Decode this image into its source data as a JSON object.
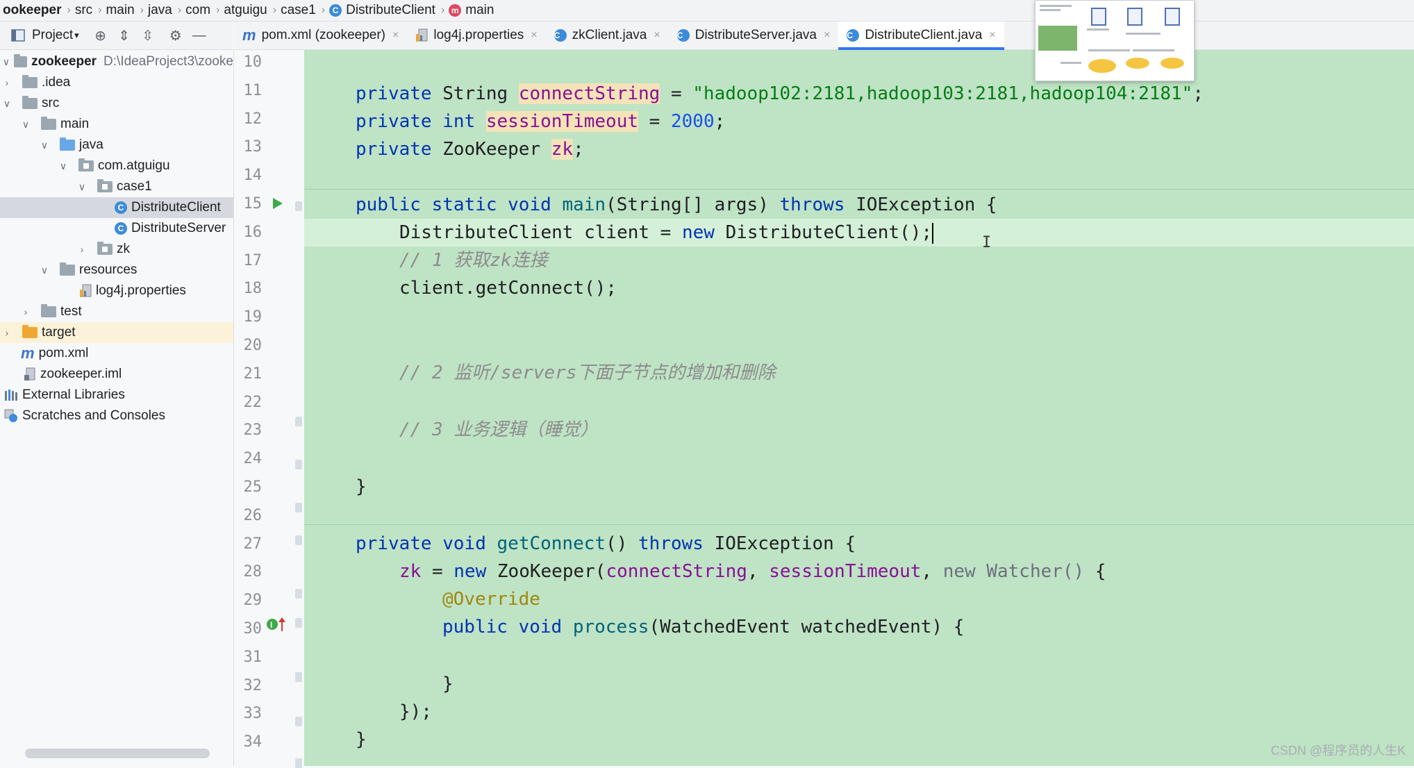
{
  "breadcrumb": [
    "ookeeper",
    "src",
    "main",
    "java",
    "com",
    "atguigu",
    "case1",
    "DistributeClient",
    "main"
  ],
  "project_toolbar": {
    "view_label": "Project"
  },
  "tabs": [
    {
      "label": "pom.xml (zookeeper)",
      "icon": "maven-icon"
    },
    {
      "label": "log4j.properties",
      "icon": "properties-icon"
    },
    {
      "label": "zkClient.java",
      "icon": "class-icon"
    },
    {
      "label": "DistributeServer.java",
      "icon": "class-icon"
    },
    {
      "label": "DistributeClient.java",
      "icon": "class-icon",
      "active": true
    }
  ],
  "tree": {
    "root_name": "zookeeper",
    "root_path": "D:\\IdeaProject3\\zooke",
    "idea": ".idea",
    "src": "src",
    "main": "main",
    "java": "java",
    "pkg": "com.atguigu",
    "case1": "case1",
    "client": "DistributeClient",
    "server": "DistributeServer",
    "zk": "zk",
    "resources": "resources",
    "log4j": "log4j.properties",
    "test": "test",
    "target": "target",
    "pom": "pom.xml",
    "iml": "zookeeper.iml",
    "ext": "External Libraries",
    "scratches": "Scratches and Consoles"
  },
  "line_numbers": [
    "10",
    "11",
    "12",
    "13",
    "14",
    "15",
    "16",
    "17",
    "18",
    "19",
    "20",
    "21",
    "22",
    "23",
    "24",
    "25",
    "26",
    "27",
    "28",
    "29",
    "30",
    "31",
    "32",
    "33",
    "34"
  ],
  "code": {
    "l11_str": "\"hadoop102:2181,hadoop103:2181,hadoop104:2181\"",
    "l12_num": "2000",
    "l17_comment": "// 1 获取zk连接",
    "l21_comment": "// 2 监听/servers下面子节点的增加和删除",
    "l23_comment": "// 3 业务逻辑（睡觉）"
  },
  "watermark": "CSDN @程序员的人生K"
}
